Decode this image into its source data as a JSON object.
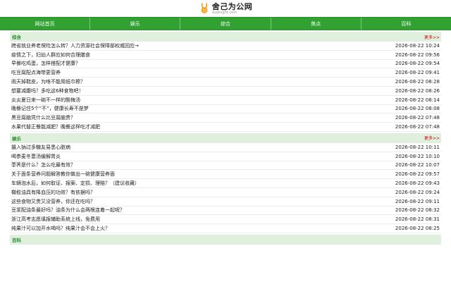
{
  "site": {
    "title": "舍己为公网",
    "subtitle": "sujanight.com"
  },
  "nav": [
    "网站首页",
    "娱乐",
    "综合",
    "焦点",
    "百科"
  ],
  "sections": [
    {
      "title": "综合",
      "more": "更多>>",
      "items": [
        {
          "title": "跨省就业养老保险怎么转？人力资源社会保障部权威回应→",
          "date": "2026-08-22 10:24"
        },
        {
          "title": "疫情之下，妇幼人群应如何合理膳食",
          "date": "2026-08-22 09:56"
        },
        {
          "title": "早餐吃鸡蛋，怎样搭配才健康？",
          "date": "2026-08-22 09:54"
        },
        {
          "title": "吃豆腐配点海带更营养",
          "date": "2026-08-22 09:41"
        },
        {
          "title": "雨天掉鞋皮，为啥不能用纸巾擦？",
          "date": "2026-08-22 08:28"
        },
        {
          "title": "想要减腹吗？多吃这6种食物吧！",
          "date": "2026-08-22 08:26"
        },
        {
          "title": "炎炎夏日来一碗不一样的酸梅汤",
          "date": "2026-08-22 08:14"
        },
        {
          "title": "晚餐记住5个“不”，健康长寿不是梦",
          "date": "2026-08-22 08:08"
        },
        {
          "title": "黑豆腐脑凭什么比豆腐脑贵？",
          "date": "2026-08-22 07:48"
        },
        {
          "title": "水果代替正餐能减肥？晚餐这样吃才减肥",
          "date": "2026-08-22 07:48"
        }
      ]
    },
    {
      "title": "娱乐",
      "more": "更多>>",
      "items": [
        {
          "title": "摄入钠过多糖友易患心脏病",
          "date": "2026-08-22 10:11"
        },
        {
          "title": "喝参麦冬薏汤缓解胃炎",
          "date": "2026-08-22 10:10"
        },
        {
          "title": "荸荠是什么？怎么吃最有效？",
          "date": "2026-08-22 10:07"
        },
        {
          "title": "关于面条营养问题解答教你做出一碗健康营养面",
          "date": "2026-08-22 09:57"
        },
        {
          "title": "车辆泡水后，如何取证、报案、定损、理赔？（建议收藏）",
          "date": "2026-08-22 09:43"
        },
        {
          "title": "橄榄油具有降血压的功效？有依据吗？",
          "date": "2026-08-22 09:24"
        },
        {
          "title": "这些食物又贵又没营养，你还在吃吗？",
          "date": "2026-08-22 09:11"
        },
        {
          "title": "豆浆配油条最好吗？油条为什么会两根连着一起呢？",
          "date": "2026-08-22 08:32"
        },
        {
          "title": "浙江高考志愿填报辅助系统上线，免费用",
          "date": "2026-08-22 08:31"
        },
        {
          "title": "纯果汁可以加开水喝吗？纯果汁会不会上火？",
          "date": "2026-08-22 08:25"
        }
      ]
    },
    {
      "title": "百科",
      "more": "",
      "items": []
    }
  ]
}
